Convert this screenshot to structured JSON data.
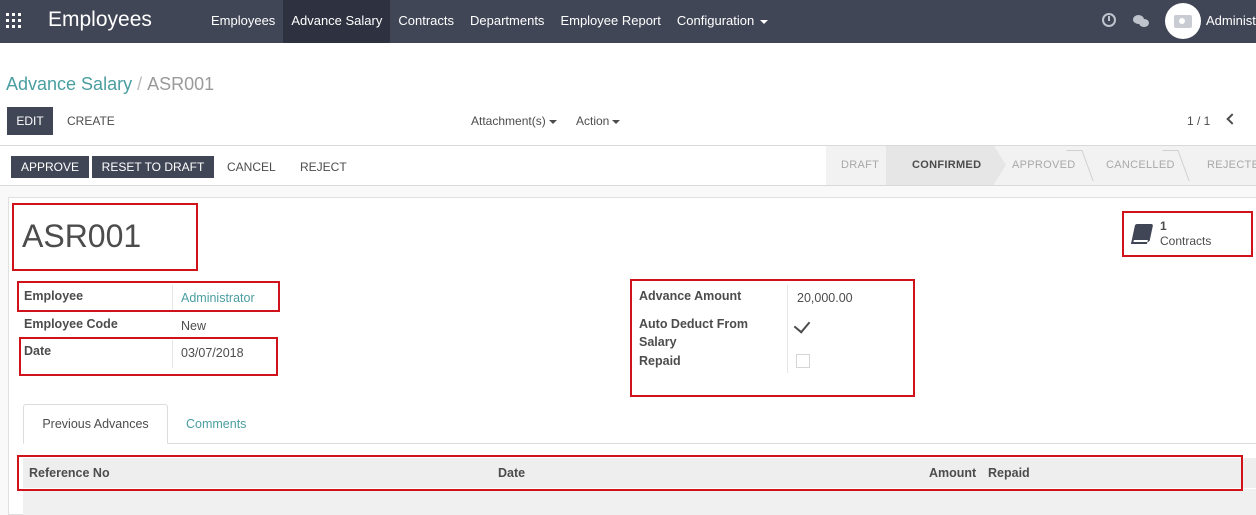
{
  "navbar": {
    "brand": "Employees",
    "menu": [
      {
        "label": "Employees",
        "active": false
      },
      {
        "label": "Advance Salary",
        "active": true
      },
      {
        "label": "Contracts",
        "active": false
      },
      {
        "label": "Departments",
        "active": false
      },
      {
        "label": "Employee Report",
        "active": false
      },
      {
        "label": "Configuration",
        "active": false
      }
    ],
    "user_name": "Administ",
    "icons": [
      "apps-icon",
      "clock-icon",
      "chat-icon",
      "camera-icon"
    ]
  },
  "breadcrumb": {
    "parent": "Advance Salary",
    "separator": "/",
    "current": "ASR001"
  },
  "control_panel": {
    "edit_label": "EDIT",
    "create_label": "CREATE",
    "attachments_label": "Attachment(s)",
    "action_label": "Action",
    "pager": "1 / 1"
  },
  "statusbar": {
    "buttons": {
      "approve": "APPROVE",
      "reset": "RESET TO DRAFT",
      "cancel": "CANCEL",
      "reject": "REJECT"
    },
    "stages": [
      "DRAFT",
      "CONFIRMED",
      "APPROVED",
      "CANCELLED",
      "REJECTE"
    ],
    "current_stage": "CONFIRMED"
  },
  "form": {
    "name": "ASR001",
    "smart_button": {
      "count": "1",
      "label": "Contracts"
    },
    "left": {
      "employee_label": "Employee",
      "employee_value": "Administrator",
      "code_label": "Employee Code",
      "code_value": "New",
      "date_label": "Date",
      "date_value": "03/07/2018"
    },
    "right": {
      "amount_label": "Advance Amount",
      "amount_value": "20,000.00",
      "auto_deduct_label_1": "Auto Deduct From",
      "auto_deduct_label_2": "Salary",
      "auto_deduct_checked": true,
      "repaid_label": "Repaid",
      "repaid_checked": false
    },
    "tabs": [
      "Previous Advances",
      "Comments"
    ],
    "table_headers": [
      "Reference No",
      "Date",
      "Amount",
      "Repaid"
    ]
  },
  "colors": {
    "navbar": "#414656",
    "link": "#4a9ea0",
    "highlight": "#d0121b"
  }
}
